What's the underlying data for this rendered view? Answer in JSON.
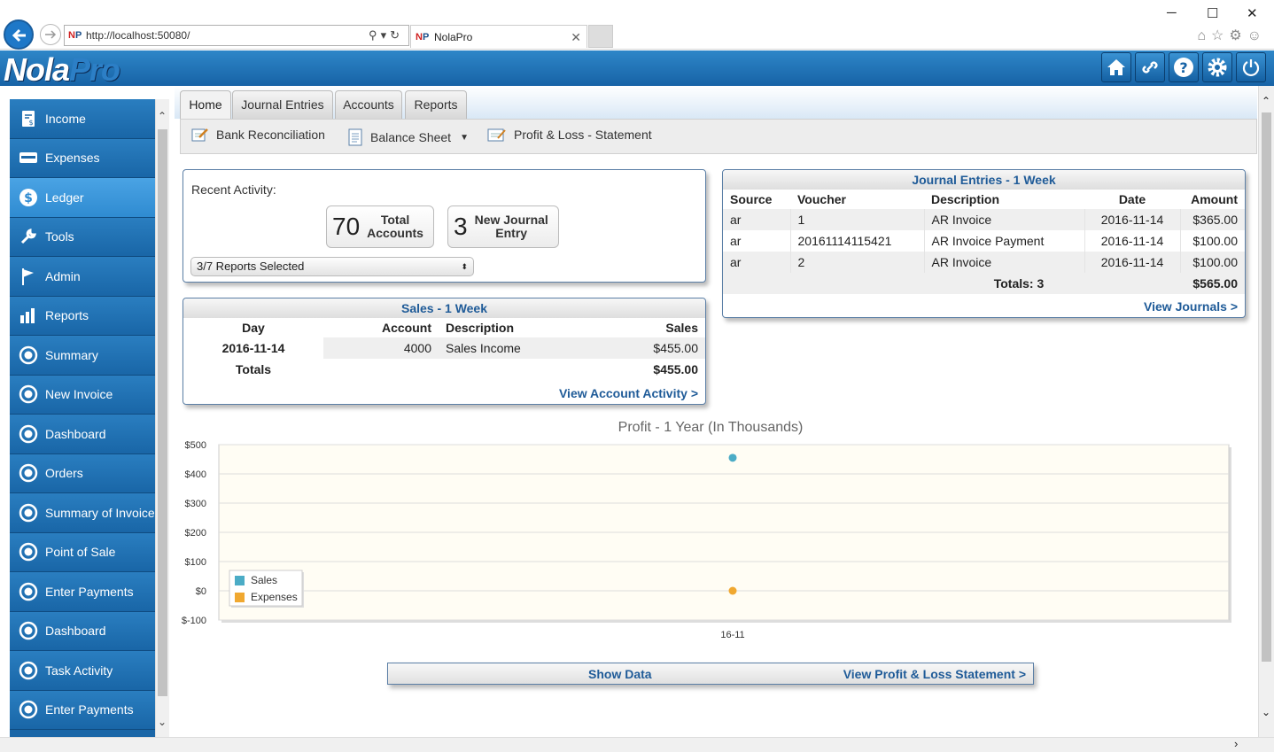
{
  "browser": {
    "url": "http://localhost:50080/",
    "tab_title": "NolaPro",
    "favicon": "NP",
    "min": "─",
    "max": "☐",
    "close": "✕"
  },
  "app": {
    "logo_part1": "Nola",
    "logo_part2": "Pro",
    "header_icons": [
      "home-icon",
      "link-icon",
      "help-icon",
      "gear-icon",
      "power-icon"
    ]
  },
  "sidebar": {
    "items": [
      {
        "label": "Income",
        "icon": "income-icon"
      },
      {
        "label": "Expenses",
        "icon": "expenses-icon"
      },
      {
        "label": "Ledger",
        "icon": "ledger-icon"
      },
      {
        "label": "Tools",
        "icon": "wrench-icon"
      },
      {
        "label": "Admin",
        "icon": "flag-icon"
      },
      {
        "label": "Reports",
        "icon": "bar-chart-icon"
      },
      {
        "label": "Summary",
        "icon": "circle-icon"
      },
      {
        "label": "New Invoice",
        "icon": "circle-icon"
      },
      {
        "label": "Dashboard",
        "icon": "circle-icon"
      },
      {
        "label": "Orders",
        "icon": "circle-icon"
      },
      {
        "label": "Summary of Invoices",
        "icon": "circle-icon"
      },
      {
        "label": "Point of Sale",
        "icon": "circle-icon"
      },
      {
        "label": "Enter Payments",
        "icon": "circle-icon"
      },
      {
        "label": "Dashboard",
        "icon": "circle-icon"
      },
      {
        "label": "Task Activity",
        "icon": "circle-icon"
      },
      {
        "label": "Enter Payments",
        "icon": "circle-icon"
      }
    ],
    "active_index": 2
  },
  "tabs": [
    "Home",
    "Journal Entries",
    "Accounts",
    "Reports"
  ],
  "toolbar": {
    "bank_reconciliation": "Bank Reconciliation",
    "balance_sheet": "Balance Sheet",
    "profit_loss": "Profit & Loss - Statement"
  },
  "recent_activity": {
    "label": "Recent Activity:",
    "total_accounts_value": "70",
    "total_accounts_label_1": "Total",
    "total_accounts_label_2": "Accounts",
    "new_journal_value": "3",
    "new_journal_label_1": "New Journal",
    "new_journal_label_2": "Entry",
    "reports_selected": "3/7 Reports Selected"
  },
  "sales": {
    "title": "Sales - 1 Week",
    "headers": [
      "Day",
      "Account",
      "Description",
      "Sales"
    ],
    "rows": [
      {
        "day": "2016-11-14",
        "account": "4000",
        "description": "Sales Income",
        "sales": "$455.00"
      }
    ],
    "totals_label": "Totals",
    "totals_value": "$455.00",
    "link": "View Account Activity >"
  },
  "journals": {
    "title": "Journal Entries - 1 Week",
    "headers": [
      "Source",
      "Voucher",
      "Description",
      "Date",
      "Amount"
    ],
    "rows": [
      {
        "source": "ar",
        "voucher": "1",
        "description": "AR Invoice",
        "date": "2016-11-14",
        "amount": "$365.00"
      },
      {
        "source": "ar",
        "voucher": "20161114115421",
        "description": "AR Invoice Payment",
        "date": "2016-11-14",
        "amount": "$100.00"
      },
      {
        "source": "ar",
        "voucher": "2",
        "description": "AR Invoice",
        "date": "2016-11-14",
        "amount": "$100.00"
      }
    ],
    "totals_label": "Totals: 3",
    "totals_value": "$565.00",
    "link": "View Journals >"
  },
  "chart_data": {
    "type": "scatter",
    "title": "Profit - 1 Year (In Thousands)",
    "categories": [
      "16-11"
    ],
    "series": [
      {
        "name": "Sales",
        "values": [
          455
        ],
        "color": "#4bacc6"
      },
      {
        "name": "Expenses",
        "values": [
          0
        ],
        "color": "#f0a830"
      }
    ],
    "ylim": [
      -100,
      500
    ],
    "yticks": [
      "$500",
      "$400",
      "$300",
      "$200",
      "$100",
      "$0",
      "$-100"
    ],
    "ytick_values": [
      500,
      400,
      300,
      200,
      100,
      0,
      -100
    ],
    "grid": true,
    "legend": "bottom-left"
  },
  "bottom": {
    "show_data": "Show Data",
    "view_pl": "View Profit & Loss Statement >"
  }
}
